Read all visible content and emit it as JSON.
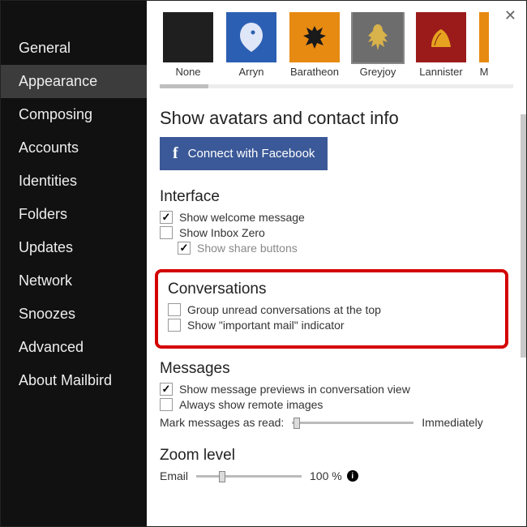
{
  "sidebar": {
    "items": [
      {
        "label": "General"
      },
      {
        "label": "Appearance"
      },
      {
        "label": "Composing"
      },
      {
        "label": "Accounts"
      },
      {
        "label": "Identities"
      },
      {
        "label": "Folders"
      },
      {
        "label": "Updates"
      },
      {
        "label": "Network"
      },
      {
        "label": "Snoozes"
      },
      {
        "label": "Advanced"
      },
      {
        "label": "About Mailbird"
      }
    ],
    "selected_index": 1
  },
  "themes": {
    "items": [
      {
        "label": "None"
      },
      {
        "label": "Arryn"
      },
      {
        "label": "Baratheon"
      },
      {
        "label": "Greyjoy"
      },
      {
        "label": "Lannister"
      },
      {
        "label": "M"
      }
    ],
    "selected_index": 3
  },
  "avatars": {
    "title": "Show avatars and contact info",
    "facebook_button": "Connect with Facebook"
  },
  "interface": {
    "title": "Interface",
    "welcome": {
      "label": "Show welcome message",
      "checked": true
    },
    "inbox_zero": {
      "label": "Show Inbox Zero",
      "checked": false
    },
    "share_buttons": {
      "label": "Show share buttons",
      "checked": true
    }
  },
  "conversations": {
    "title": "Conversations",
    "group_unread": {
      "label": "Group unread conversations at the top",
      "checked": false
    },
    "important": {
      "label": "Show \"important mail\" indicator",
      "checked": false
    }
  },
  "messages": {
    "title": "Messages",
    "previews": {
      "label": "Show message previews in conversation view",
      "checked": true
    },
    "remote_images": {
      "label": "Always show remote images",
      "checked": false
    },
    "mark_read_label": "Mark messages as read:",
    "mark_read_value": "Immediately"
  },
  "zoom": {
    "title": "Zoom level",
    "email_label": "Email",
    "email_value": "100 %"
  }
}
